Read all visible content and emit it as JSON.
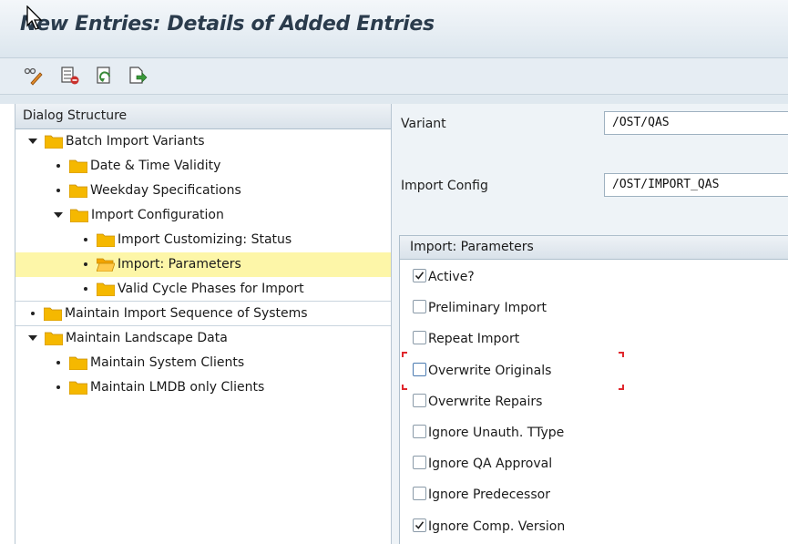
{
  "window": {
    "title": "New Entries: Details of Added Entries"
  },
  "toolbar": {
    "buttons": [
      {
        "icon": "glasses-pencil-icon"
      },
      {
        "icon": "delete-entry-icon"
      },
      {
        "icon": "undo-change-icon"
      },
      {
        "icon": "next-entry-icon"
      }
    ]
  },
  "dialog_structure": {
    "header": "Dialog Structure",
    "items": [
      {
        "label": "Batch Import Variants",
        "level": 0,
        "expander": "expanded"
      },
      {
        "label": "Date & Time Validity",
        "level": 1,
        "expander": "leaf"
      },
      {
        "label": "Weekday Specifications",
        "level": 1,
        "expander": "leaf"
      },
      {
        "label": "Import Configuration",
        "level": 1,
        "expander": "expanded"
      },
      {
        "label": "Import Customizing: Status",
        "level": 2,
        "expander": "leaf"
      },
      {
        "label": "Import: Parameters",
        "level": 2,
        "expander": "leaf",
        "selected": true,
        "open_folder": true
      },
      {
        "label": "Valid Cycle Phases for Import",
        "level": 2,
        "expander": "leaf"
      },
      {
        "label": "Maintain Import Sequence of Systems",
        "level": 0,
        "expander": "leaf"
      },
      {
        "label": "Maintain Landscape Data",
        "level": 0,
        "expander": "expanded"
      },
      {
        "label": "Maintain System Clients",
        "level": 1,
        "expander": "leaf"
      },
      {
        "label": "Maintain LMDB only Clients",
        "level": 1,
        "expander": "leaf"
      }
    ]
  },
  "fields": {
    "variant": {
      "label": "Variant",
      "value": "/OST/QAS"
    },
    "import_config": {
      "label": "Import Config",
      "value": "/OST/IMPORT_QAS"
    }
  },
  "parameters": {
    "header": "Import: Parameters",
    "checkboxes": [
      {
        "label": "Active?",
        "checked": true
      },
      {
        "label": "Preliminary Import",
        "checked": false
      },
      {
        "label": "Repeat Import",
        "checked": false
      },
      {
        "label": "Overwrite Originals",
        "checked": false,
        "focused": true
      },
      {
        "label": "Overwrite Repairs",
        "checked": false
      },
      {
        "label": "Ignore Unauth. TType",
        "checked": false
      },
      {
        "label": "Ignore QA Approval",
        "checked": false
      },
      {
        "label": "Ignore Predecessor",
        "checked": false
      },
      {
        "label": "Ignore Comp. Version",
        "checked": true
      }
    ]
  },
  "colors": {
    "selection": "#fdf6a8",
    "folder": "#f5b800",
    "focus_bracket": "#e0282e"
  }
}
